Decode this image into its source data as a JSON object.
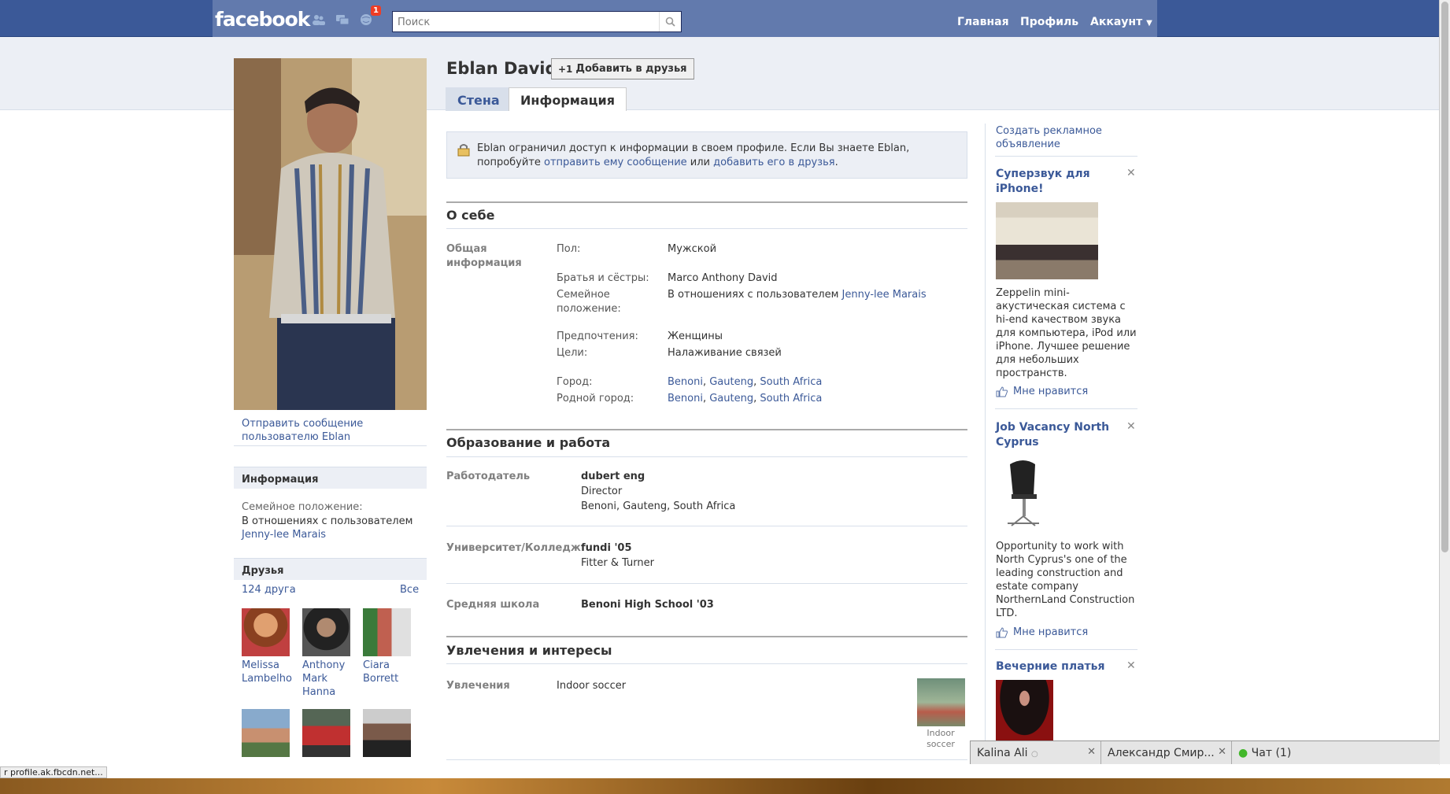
{
  "topbar": {
    "logo": "facebook",
    "notification_count": "1",
    "search_placeholder": "Поиск",
    "nav": {
      "home": "Главная",
      "profile": "Профиль",
      "account": "Аккаунт"
    }
  },
  "profile": {
    "name": "Eblan David",
    "add_friend": "Добавить в друзья",
    "send_message": "Отправить сообщение пользователю Eblan",
    "tabs": {
      "wall": "Стена",
      "info": "Информация"
    }
  },
  "left": {
    "info_title": "Информация",
    "relationship_label": "Семейное положение:",
    "relationship_value": "В отношениях с пользователем",
    "relationship_partner": "Jenny-lee Marais",
    "friends_title": "Друзья",
    "friends_count": "124 друга",
    "friends_all": "Все",
    "friends": [
      {
        "name": "Melissa Lambelho"
      },
      {
        "name": "Anthony Mark Hanna"
      },
      {
        "name": "Ciara Borrett"
      }
    ]
  },
  "notice": {
    "text1": "Eblan ограничил доступ к информации в своем профиле. Если Вы знаете Eblan, попробуйте ",
    "link1": "отправить ему сообщение",
    "text2": " или ",
    "link2": "добавить его в друзья",
    "text3": "."
  },
  "about": {
    "title": "О себе",
    "group_label": "Общая информация",
    "gender_label": "Пол:",
    "gender_value": "Мужской",
    "siblings_label": "Братья и сёстры:",
    "siblings_value": "Marco Anthony David",
    "relationship_label": "Семейное положение:",
    "relationship_value": "В отношениях с пользователем",
    "relationship_partner": "Jenny-lee Marais",
    "interested_label": "Предпочтения:",
    "interested_value": "Женщины",
    "looking_label": "Цели:",
    "looking_value": "Налаживание связей",
    "city_label": "Город:",
    "hometown_label": "Родной город:",
    "loc1": "Benoni",
    "loc2": "Gauteng",
    "loc3": "South Africa",
    "sep": ", "
  },
  "education": {
    "title": "Образование и работа",
    "employer_label": "Работодатель",
    "employer": "dubert eng",
    "position": "Director",
    "employer_location": "Benoni, Gauteng, South Africa",
    "college_label": "Университет/Колледж",
    "college": "fundi '05",
    "college_concentration": "Fitter & Turner",
    "highschool_label": "Средняя школа",
    "highschool": "Benoni High School '03"
  },
  "interests": {
    "title": "Увлечения и интересы",
    "activities_label": "Увлечения",
    "activity": "Indoor soccer",
    "activity_caption": "Indoor soccer"
  },
  "ads": {
    "create_ad": "Создать рекламное объявление",
    "items": [
      {
        "title": "Суперзвук для iPhone!",
        "text": "Zeppelin mini-акустическая система с hi-end качеством звука для компьютера, iPod или iPhone. Лучшее решение для небольших пространств.",
        "like": "Мне нравится"
      },
      {
        "title": "Job Vacancy North Cyprus",
        "text": "Opportunity to work with North Cyprus's one of the leading construction and estate company NorthernLand Construction LTD.",
        "like": "Мне нравится"
      },
      {
        "title": "Вечерние платья"
      }
    ]
  },
  "chat": {
    "tab1": "Kalina Ali",
    "tab2": "Александр Смир...",
    "tab3": "Чат (1)"
  },
  "status_bar": "r profile.ak.fbcdn.net..."
}
